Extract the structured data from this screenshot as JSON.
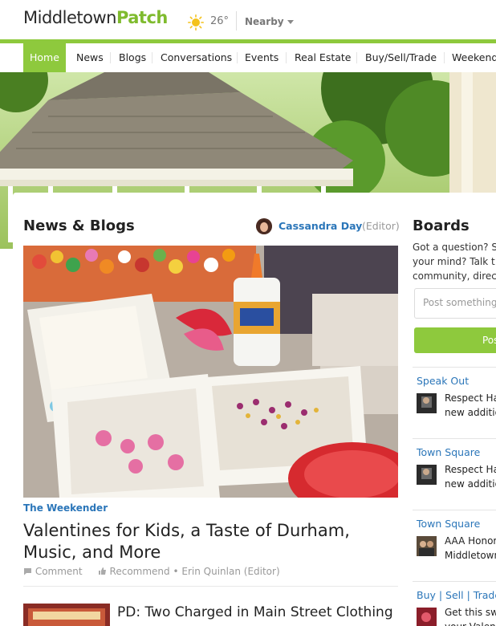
{
  "header": {
    "logo_town": "Middletown",
    "logo_patch": "Patch",
    "weather_icon": "sun-icon",
    "temperature": "26°",
    "nearby_label": "Nearby"
  },
  "nav": {
    "items": [
      {
        "label": "Home",
        "active": true
      },
      {
        "label": "News"
      },
      {
        "label": "Blogs"
      },
      {
        "label": "Conversations"
      },
      {
        "label": "Events"
      },
      {
        "label": "Real Estate"
      },
      {
        "label": "Buy/Sell/Trade"
      },
      {
        "label": "Weekender"
      }
    ]
  },
  "news": {
    "section_title": "News & Blogs",
    "editor_name": "Cassandra Day",
    "editor_role": "(Editor)",
    "feature": {
      "kicker": "The Weekender",
      "headline": "Valentines for Kids, a Taste of Durham, Music, and More",
      "comment_label": "Comment",
      "recommend_label": "Recommend",
      "separator": "•",
      "author": "Erin Quinlan (Editor)"
    },
    "second_story_title": "PD: Two Charged in Main Street Clothing Shop Counterfeit"
  },
  "boards": {
    "title": "Boards",
    "intro_lines": [
      "Got a question? S",
      "your mind? Talk t",
      "community, direc"
    ],
    "post_placeholder": "Post something",
    "post_button": "Pos",
    "items": [
      {
        "label": "Speak Out",
        "lines": [
          "Respect Ha",
          "new additio"
        ]
      },
      {
        "label": "Town Square",
        "lines": [
          "Respect Ha",
          "new additio"
        ]
      },
      {
        "label": "Town Square",
        "lines": [
          "AAA Honor",
          "Middletown"
        ]
      },
      {
        "label": "Buy | Sell | Trade",
        "lines": [
          "Get this sw",
          "your Valent"
        ]
      }
    ]
  },
  "colors": {
    "brand_green": "#8ec93d",
    "link_blue": "#2b76b9"
  }
}
